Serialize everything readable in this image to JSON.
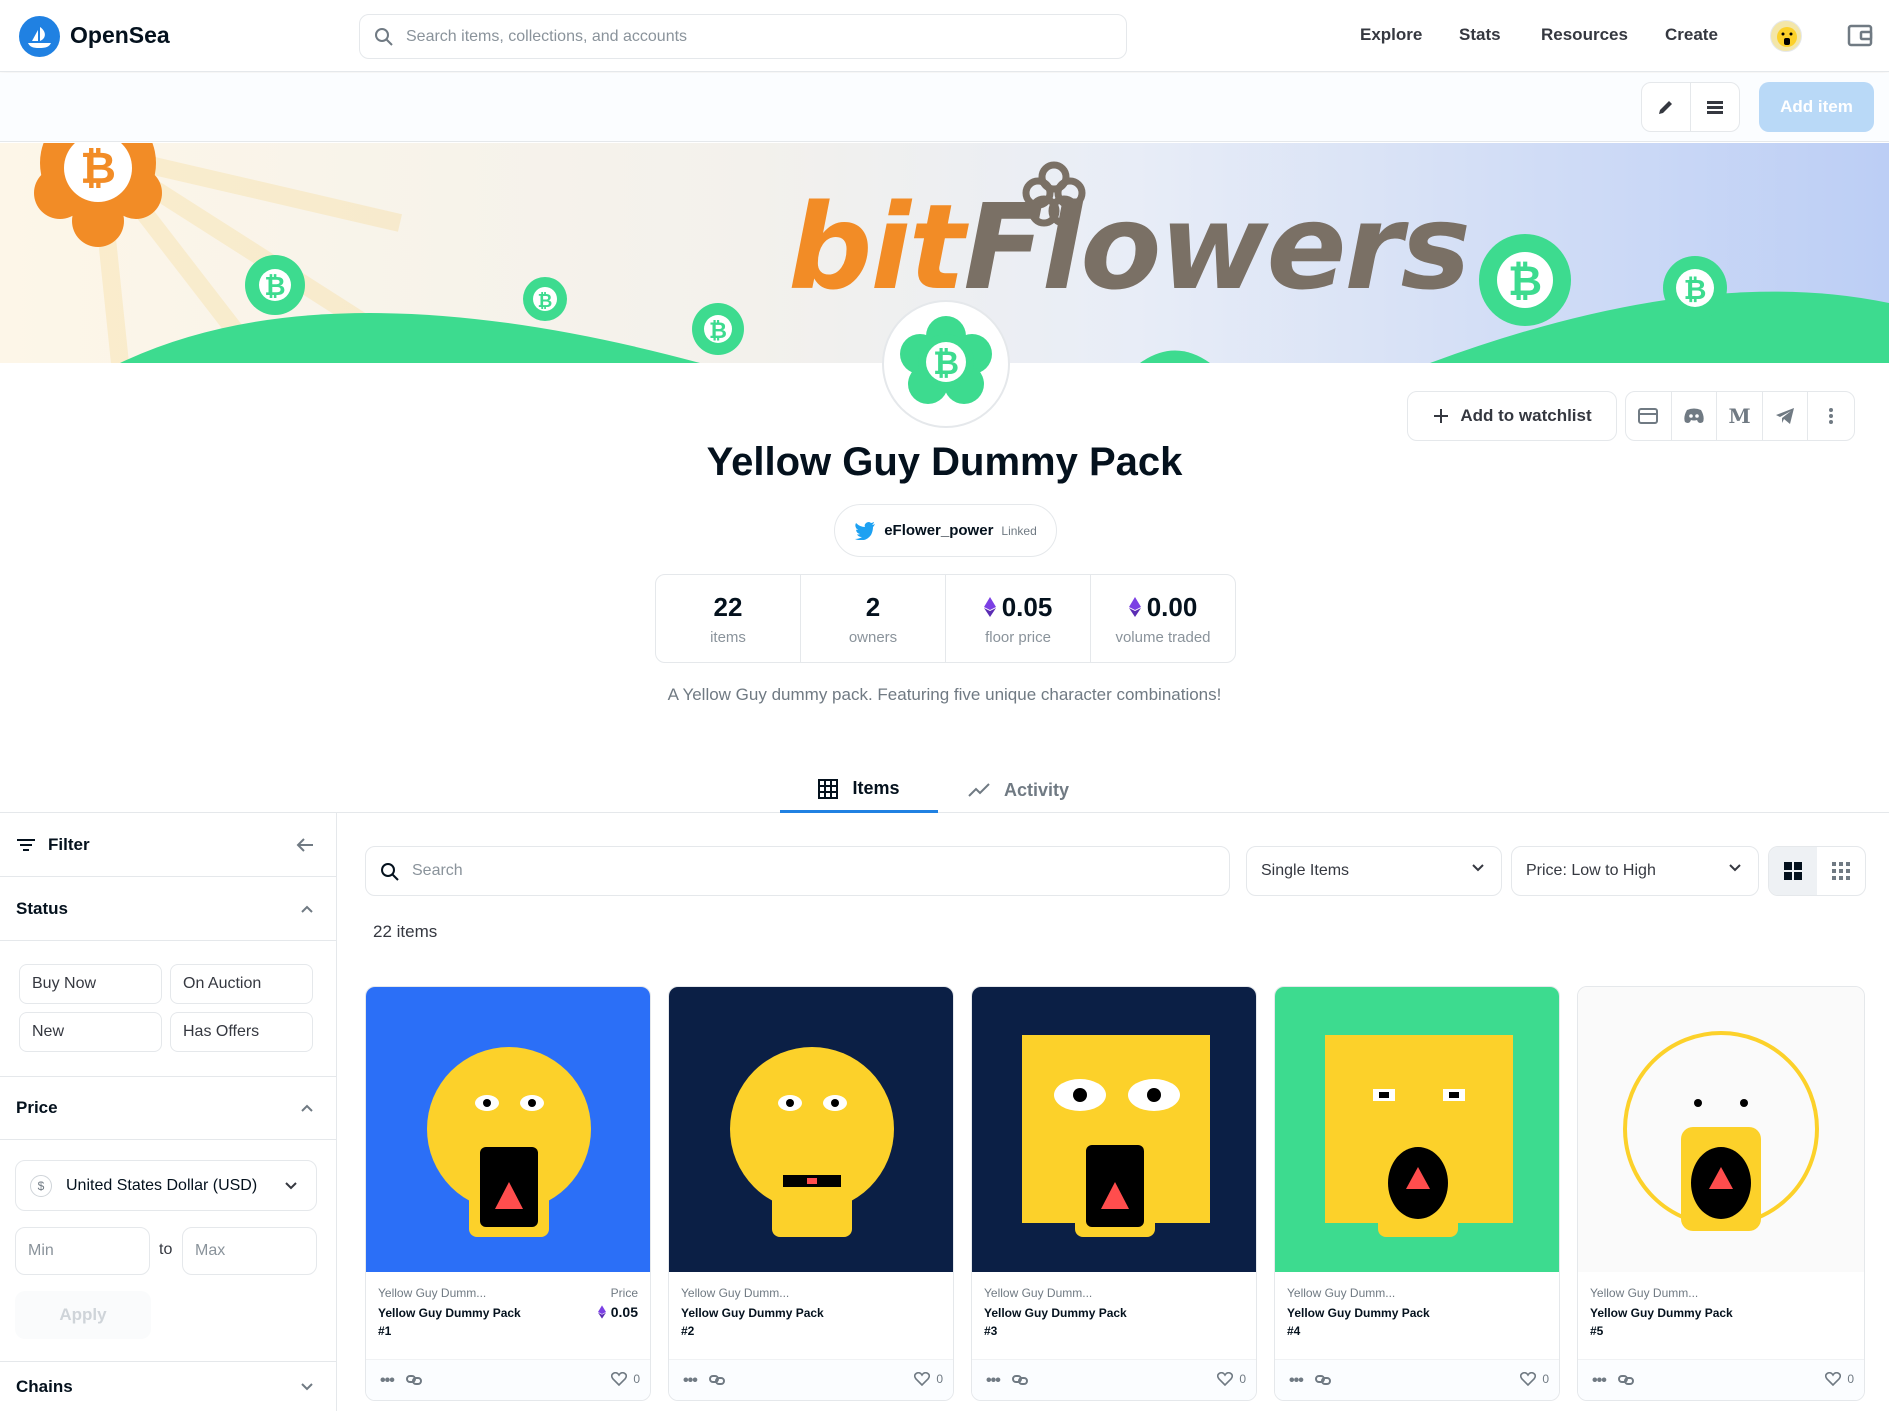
{
  "nav": {
    "logo_text": "OpenSea",
    "search_placeholder": "Search items, collections, and accounts",
    "links": [
      "Explore",
      "Stats",
      "Resources",
      "Create"
    ]
  },
  "owner_toolbar": {
    "add_item_label": "Add item"
  },
  "banner": {
    "title_part1": "bit",
    "title_part2": "Flowers"
  },
  "collection": {
    "title": "Yellow Guy Dummy Pack",
    "twitter_handle": "eFlower_power",
    "twitter_status": "Linked",
    "watchlist_label": "Add to watchlist",
    "link_m_label": "M",
    "description": "A Yellow Guy dummy pack. Featuring five unique character combinations!",
    "stats": [
      {
        "value": "22",
        "label": "items",
        "eth": false
      },
      {
        "value": "2",
        "label": "owners",
        "eth": false
      },
      {
        "value": "0.05",
        "label": "floor price",
        "eth": true
      },
      {
        "value": "0.00",
        "label": "volume traded",
        "eth": true
      }
    ]
  },
  "tabs": {
    "items": "Items",
    "activity": "Activity"
  },
  "sidebar": {
    "filter_label": "Filter",
    "status_label": "Status",
    "status_options": [
      "Buy Now",
      "On Auction",
      "New",
      "Has Offers"
    ],
    "price_label": "Price",
    "currency_symbol": "$",
    "currency": "United States Dollar (USD)",
    "min_placeholder": "Min",
    "to_label": "to",
    "max_placeholder": "Max",
    "apply_label": "Apply",
    "chains_label": "Chains"
  },
  "main": {
    "search_placeholder": "Search",
    "type_select": "Single Items",
    "sort_select": "Price: Low to High",
    "items_count": "22 items"
  },
  "cards": [
    {
      "collection": "Yellow Guy Dumm...",
      "name": "Yellow Guy Dummy Pack #1",
      "price_label": "Price",
      "price": "0.05",
      "favorites": "0",
      "bg": "#2b6ff7"
    },
    {
      "collection": "Yellow Guy Dumm...",
      "name": "Yellow Guy Dummy Pack #2",
      "price_label": "",
      "price": "",
      "favorites": "0",
      "bg": "#0b1f45"
    },
    {
      "collection": "Yellow Guy Dumm...",
      "name": "Yellow Guy Dummy Pack #3",
      "price_label": "",
      "price": "",
      "favorites": "0",
      "bg": "#0b1f45"
    },
    {
      "collection": "Yellow Guy Dumm...",
      "name": "Yellow Guy Dummy Pack #4",
      "price_label": "",
      "price": "",
      "favorites": "0",
      "bg": "#3ddb8f"
    },
    {
      "collection": "Yellow Guy Dumm...",
      "name": "Yellow Guy Dummy Pack #5",
      "price_label": "",
      "price": "",
      "favorites": "0",
      "bg": "#fafafa"
    }
  ],
  "colors": {
    "accent": "#2081e2",
    "brand_orange": "#f28c26",
    "flower_green": "#3ddb8f",
    "face_yellow": "#fcd12a",
    "eth_purple": "#7b3fe4"
  }
}
